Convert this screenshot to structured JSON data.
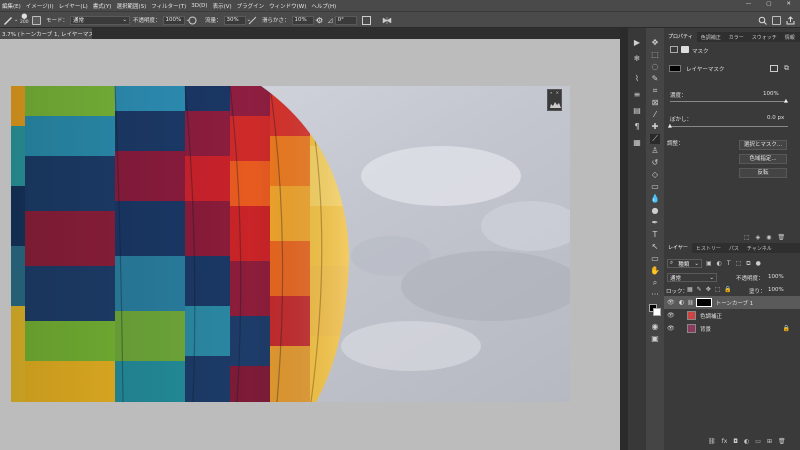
{
  "menu": {
    "items": [
      "編集(E)",
      "イメージ(I)",
      "レイヤー(L)",
      "書式(Y)",
      "選択範囲(S)",
      "フィルター(T)",
      "3D(D)",
      "表示(V)",
      "プラグイン",
      "ウィンドウ(W)",
      "ヘルプ(H)"
    ],
    "window_min": "—",
    "window_max": "▢",
    "window_close": "✕"
  },
  "options": {
    "brush_size": "200",
    "mode_label": "モード：",
    "mode_value": "通常",
    "opacity_label": "不透明度：",
    "opacity_value": "100%",
    "flow_label": "流量：",
    "flow_value": "30%",
    "smoothing_label": "滑らかさ：",
    "smoothing_value": "10%",
    "angle_value": "0°"
  },
  "document": {
    "tab_title": "3.7% (トーンカーブ 1, レイヤーマスク/8) *",
    "tab_close": "×"
  },
  "properties": {
    "tabs": [
      "プロパティ",
      "色調補正",
      "カラー",
      "スウォッチ",
      "情報"
    ],
    "mask_title": "マスク",
    "layer_mask_label": "レイヤーマスク",
    "density_label": "濃度：",
    "density_value": "100%",
    "feather_label": "ぼかし：",
    "feather_value": "0.0 px",
    "refine_label": "調整：",
    "select_and_mask_button": "選択とマスク...",
    "color_range_button": "色域指定...",
    "invert_button": "反転"
  },
  "layers": {
    "tabs": [
      "レイヤー",
      "ヒストリー",
      "パス",
      "チャンネル"
    ],
    "filter_label": "種類",
    "blend_mode": "通常",
    "opacity_label": "不透明度：",
    "opacity_value": "100%",
    "lock_label": "ロック：",
    "fill_label": "塗り：",
    "fill_value": "100%",
    "items": [
      {
        "name": "トーンカーブ 1"
      },
      {
        "name": "色調補正"
      },
      {
        "name": "背景"
      }
    ]
  },
  "colors": {
    "accent": "#1473e6",
    "panel_bg": "#3a3a3a",
    "workspace_bg": "#bcbcbc"
  }
}
